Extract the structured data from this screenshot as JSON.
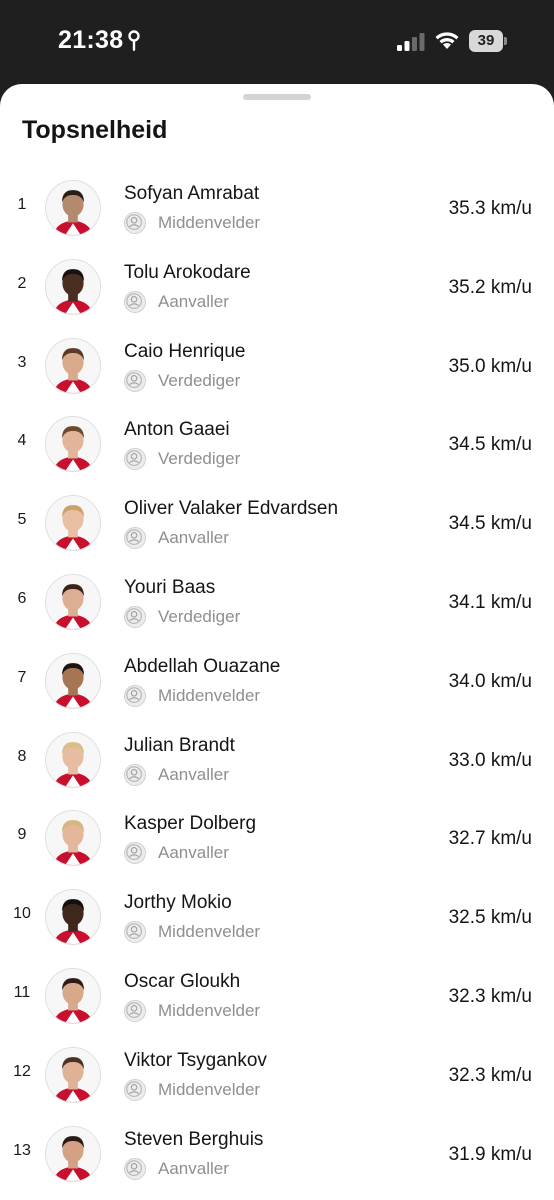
{
  "status_bar": {
    "time": "21:38",
    "battery": "39"
  },
  "title": "Topsnelheid",
  "players": [
    {
      "rank": "1",
      "name": "Sofyan Amrabat",
      "position": "Middenvelder",
      "speed": "35.3 km/u"
    },
    {
      "rank": "2",
      "name": "Tolu Arokodare",
      "position": "Aanvaller",
      "speed": "35.2 km/u"
    },
    {
      "rank": "3",
      "name": "Caio Henrique",
      "position": "Verdediger",
      "speed": "35.0 km/u"
    },
    {
      "rank": "4",
      "name": "Anton Gaaei",
      "position": "Verdediger",
      "speed": "34.5 km/u"
    },
    {
      "rank": "5",
      "name": "Oliver Valaker Edvardsen",
      "position": "Aanvaller",
      "speed": "34.5 km/u"
    },
    {
      "rank": "6",
      "name": "Youri Baas",
      "position": "Verdediger",
      "speed": "34.1 km/u"
    },
    {
      "rank": "7",
      "name": "Abdellah Ouazane",
      "position": "Middenvelder",
      "speed": "34.0 km/u"
    },
    {
      "rank": "8",
      "name": "Julian Brandt",
      "position": "Aanvaller",
      "speed": "33.0 km/u"
    },
    {
      "rank": "9",
      "name": "Kasper Dolberg",
      "position": "Aanvaller",
      "speed": "32.7 km/u"
    },
    {
      "rank": "10",
      "name": "Jorthy Mokio",
      "position": "Middenvelder",
      "speed": "32.5 km/u"
    },
    {
      "rank": "11",
      "name": "Oscar Gloukh",
      "position": "Middenvelder",
      "speed": "32.3 km/u"
    },
    {
      "rank": "12",
      "name": "Viktor Tsygankov",
      "position": "Middenvelder",
      "speed": "32.3 km/u"
    },
    {
      "rank": "13",
      "name": "Steven Berghuis",
      "position": "Aanvaller",
      "speed": "31.9 km/u"
    }
  ],
  "avatar_tones": [
    "#b48a6e",
    "#4a2e20",
    "#d9a98c",
    "#e2b49a",
    "#e8bfa4",
    "#dcae94",
    "#a67654",
    "#e6bca2",
    "#e4b79c",
    "#3f271c",
    "#d7a889",
    "#dfb297",
    "#d3a183"
  ],
  "hair_tones": [
    "#2a1d16",
    "#1a1210",
    "#5a3b28",
    "#6b4a2e",
    "#c9a26a",
    "#3a2418",
    "#1c1412",
    "#d8bf86",
    "#d4b67e",
    "#141010",
    "#2b1c14",
    "#4a3322",
    "#2a1c14"
  ],
  "colors": {
    "accent": "#c8102e",
    "sheet_bg": "#ffffff",
    "status_bg": "#1f1f1f",
    "muted_text": "#8f8f8f"
  },
  "icons": {
    "club": "ajax-crest-icon",
    "pin": "location-pin-icon",
    "signal": "signal-icon",
    "wifi": "wifi-icon"
  }
}
